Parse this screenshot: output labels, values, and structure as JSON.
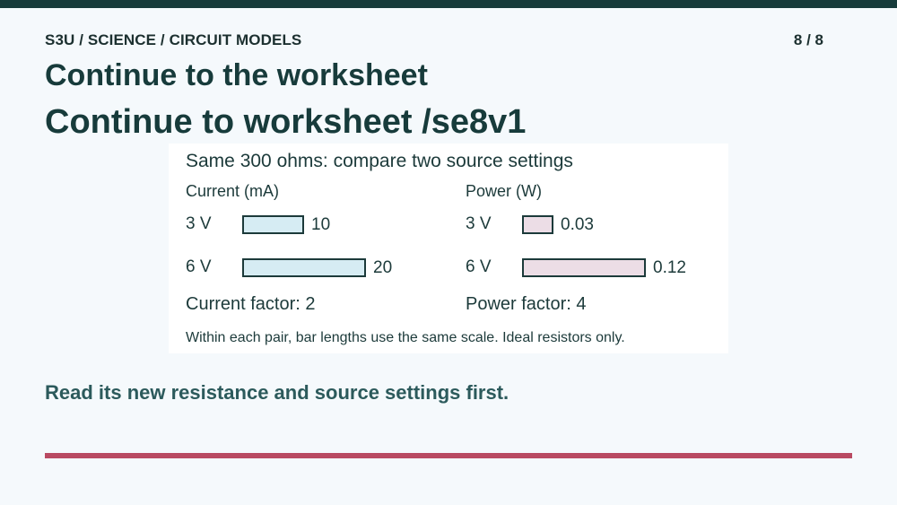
{
  "header": {
    "breadcrumb": "S3U / SCIENCE / CIRCUIT MODELS",
    "page_count": "8 / 8",
    "title": "Continue to the worksheet",
    "heading": "Continue to worksheet /se8v1"
  },
  "footer": {
    "text": "Read its new resistance and source settings first."
  },
  "colors": {
    "top_bar": "#173b3b",
    "current_bar": "#d6ecf3",
    "power_bar": "#ecdde6",
    "accent_rule": "#b94a62"
  },
  "chart_data": {
    "type": "bar",
    "orientation": "horizontal",
    "title": "Same 300 ohms: compare two source settings",
    "note": "Within each pair, bar lengths use the same scale. Ideal resistors only.",
    "panels": [
      {
        "id": "current",
        "label": "Current (mA)",
        "categories": [
          "3 V",
          "6 V"
        ],
        "values": [
          10,
          20
        ],
        "value_labels": [
          "10",
          "20"
        ],
        "factor_text": "Current factor: 2",
        "color": "#d6ecf3"
      },
      {
        "id": "power",
        "label": "Power (W)",
        "categories": [
          "3 V",
          "6 V"
        ],
        "values": [
          0.03,
          0.12
        ],
        "value_labels": [
          "0.03",
          "0.12"
        ],
        "factor_text": "Power factor: 4",
        "color": "#ecdde6"
      }
    ]
  }
}
